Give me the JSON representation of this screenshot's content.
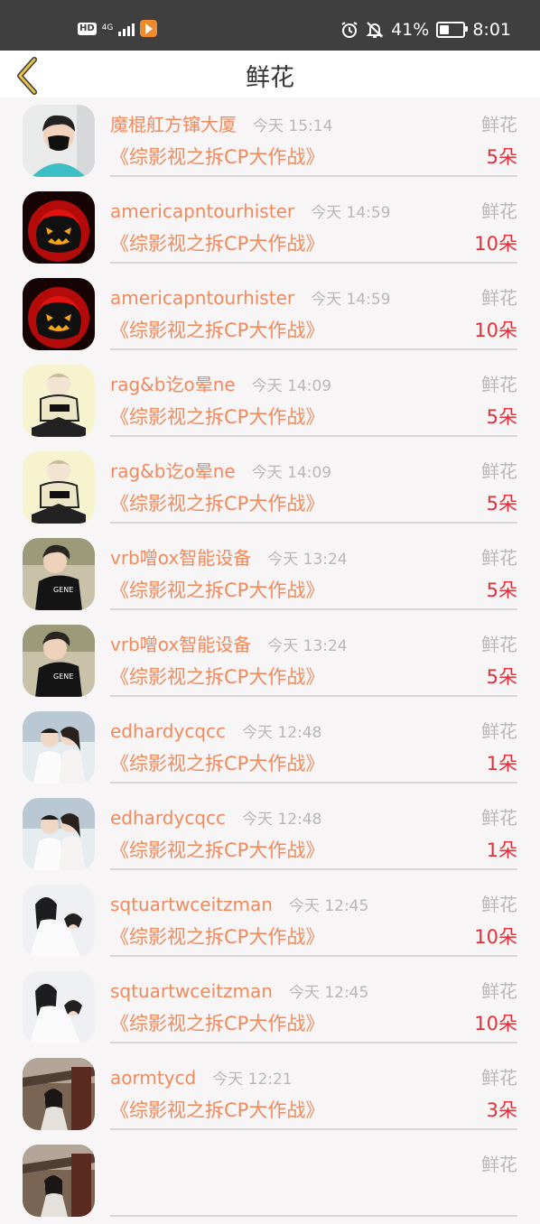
{
  "status_bar": {
    "hd": "HD",
    "network": "4G",
    "battery_percent": "41%",
    "time": "8:01"
  },
  "header": {
    "title": "鲜花"
  },
  "records": [
    {
      "user": "魔棍舡方镩大厦",
      "time": "今天 15:14",
      "gift": "鲜花",
      "room": "《综影视之拆CP大作战》",
      "count": "5朵",
      "avatar": "boy-mask"
    },
    {
      "user": "americapntourhister",
      "time": "今天 14:59",
      "gift": "鲜花",
      "room": "《综影视之拆CP大作战》",
      "count": "10朵",
      "avatar": "pumpkin"
    },
    {
      "user": "americapntourhister",
      "time": "今天 14:59",
      "gift": "鲜花",
      "room": "《综影视之拆CP大作战》",
      "count": "10朵",
      "avatar": "pumpkin"
    },
    {
      "user": "rag&b讫o晕ne",
      "time": "今天 14:09",
      "gift": "鲜花",
      "room": "《综影视之拆CP大作战》",
      "count": "5朵",
      "avatar": "anime"
    },
    {
      "user": "rag&b讫o晕ne",
      "time": "今天 14:09",
      "gift": "鲜花",
      "room": "《综影视之拆CP大作战》",
      "count": "5朵",
      "avatar": "anime"
    },
    {
      "user": "vrb噌ox智能设备",
      "time": "今天 13:24",
      "gift": "鲜花",
      "room": "《综影视之拆CP大作战》",
      "count": "5朵",
      "avatar": "boy-shirt"
    },
    {
      "user": "vrb噌ox智能设备",
      "time": "今天 13:24",
      "gift": "鲜花",
      "room": "《综影视之拆CP大作战》",
      "count": "5朵",
      "avatar": "boy-shirt"
    },
    {
      "user": "edhardycqcc",
      "time": "今天 12:48",
      "gift": "鲜花",
      "room": "《综影视之拆CP大作战》",
      "count": "1朵",
      "avatar": "couple"
    },
    {
      "user": "edhardycqcc",
      "time": "今天 12:48",
      "gift": "鲜花",
      "room": "《综影视之拆CP大作战》",
      "count": "1朵",
      "avatar": "couple"
    },
    {
      "user": "sqtuartwceitzman",
      "time": "今天 12:45",
      "gift": "鲜花",
      "room": "《综影视之拆CP大作战》",
      "count": "10朵",
      "avatar": "bride"
    },
    {
      "user": "sqtuartwceitzman",
      "time": "今天 12:45",
      "gift": "鲜花",
      "room": "《综影视之拆CP大作战》",
      "count": "10朵",
      "avatar": "bride"
    },
    {
      "user": "aormtycd",
      "time": "今天 12:21",
      "gift": "鲜花",
      "room": "《综影视之拆CP大作战》",
      "count": "3朵",
      "avatar": "street"
    },
    {
      "user": "",
      "time": "",
      "gift": "鲜花",
      "room": "",
      "count": "",
      "avatar": "street"
    }
  ]
}
